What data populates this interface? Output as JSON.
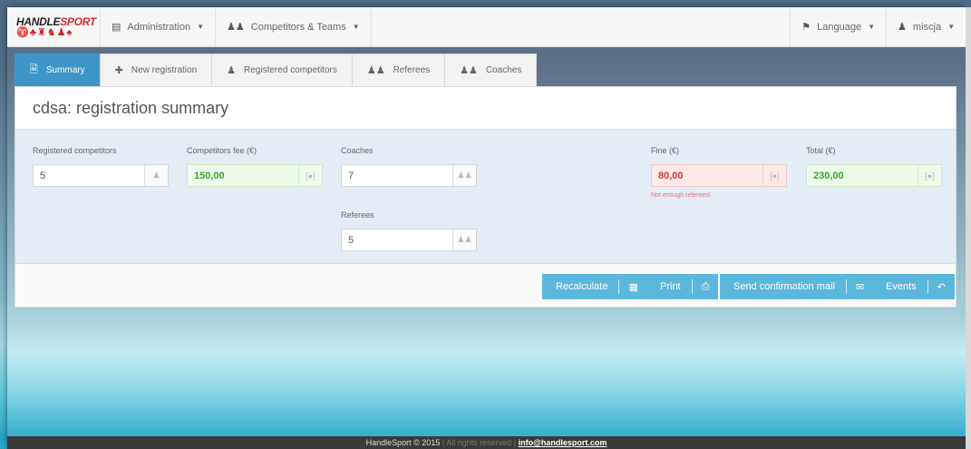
{
  "brand": {
    "name_main": "HANDLE",
    "name_accent": "SPORT",
    "figures": "♈♣♜♞♟♠"
  },
  "nav": {
    "items": [
      {
        "label": "Administration"
      },
      {
        "label": "Competitors & Teams"
      }
    ],
    "language_label": "Language",
    "user_label": "miscja"
  },
  "tabs": [
    {
      "label": "Summary"
    },
    {
      "label": "New registration"
    },
    {
      "label": "Registered competitors"
    },
    {
      "label": "Referees"
    },
    {
      "label": "Coaches"
    }
  ],
  "card": {
    "title": "cdsa: registration summary"
  },
  "fields": {
    "registered_competitors": {
      "label": "Registered competitors",
      "value": "5"
    },
    "competitors_fee": {
      "label": "Competitors fee (€)",
      "value": "150,00"
    },
    "coaches": {
      "label": "Coaches",
      "value": "7"
    },
    "referees": {
      "label": "Referees",
      "value": "5"
    },
    "fine": {
      "label": "Fine (€)",
      "value": "80,00",
      "error": "Not enough referees!"
    },
    "total": {
      "label": "Total (€)",
      "value": "230,00"
    }
  },
  "buttons": {
    "recalculate": "Recalculate",
    "print": "Print",
    "send_mail": "Send confirmation mail",
    "events": "Events"
  },
  "footer": {
    "copyright": "HandleSport © 2015",
    "rights": "All rights reserved",
    "email": "info@handlesport.com"
  },
  "colors": {
    "accent": "#3e96c8",
    "button": "#5cb7dc",
    "positive": "#3aa42f",
    "negative": "#d23a3a"
  }
}
